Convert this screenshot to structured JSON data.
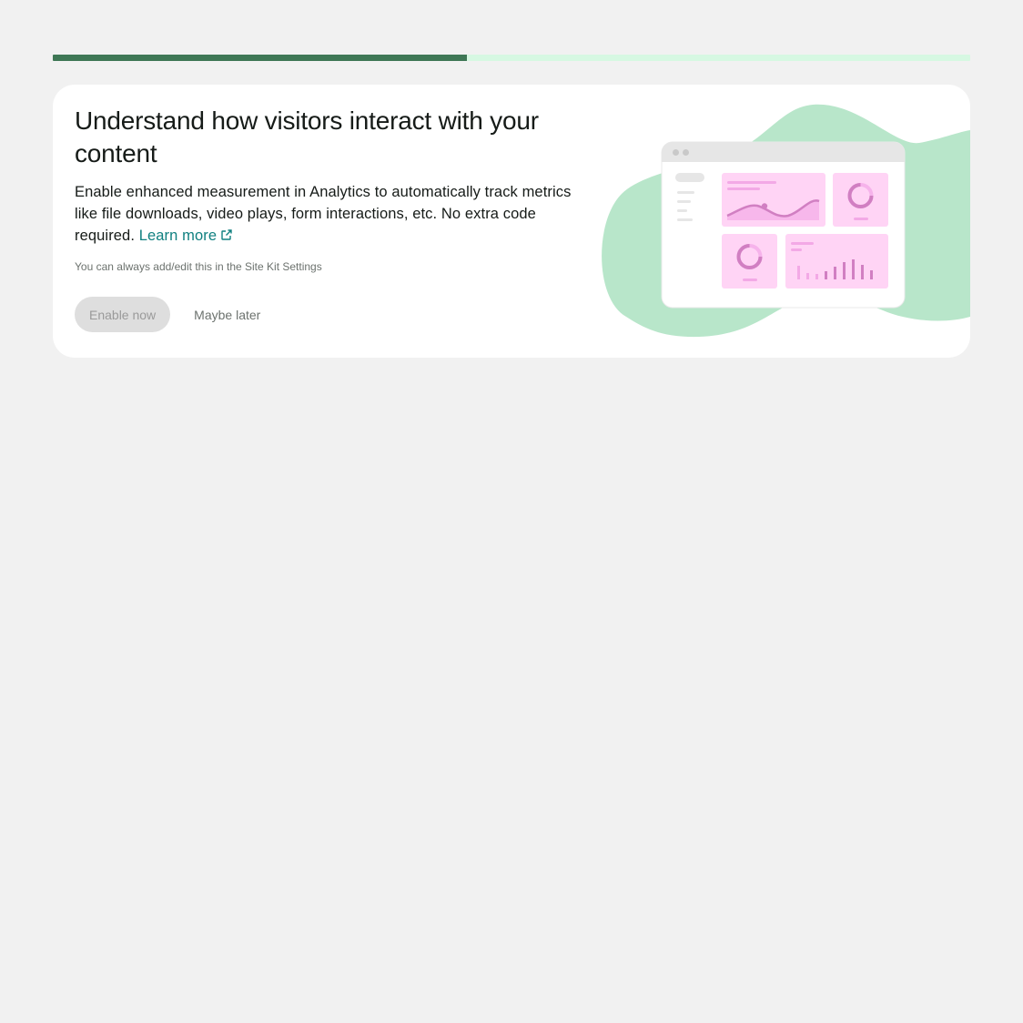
{
  "progress": {
    "fraction": 0.4514
  },
  "banner": {
    "title": "Understand how visitors interact with your content",
    "description": "Enable enhanced measurement in Analytics to automatically track metrics like file downloads, video plays, form interactions, etc. No extra code required.",
    "learn_more_label": "Learn more",
    "note": "You can always add/edit this in the Site Kit Settings",
    "primary_button_label": "Enable now",
    "secondary_button_label": "Maybe later"
  },
  "colors": {
    "page_background": "#f1f1f1",
    "progress_filled": "#3e7755",
    "progress_track": "#d6f8e2",
    "link": "#108080",
    "blob": "#b8e6ca",
    "chart_pink": "#ffd4f5",
    "chart_accent": "#d17fc2"
  },
  "illustration": {
    "icon": "analytics-dashboard-illustration"
  }
}
